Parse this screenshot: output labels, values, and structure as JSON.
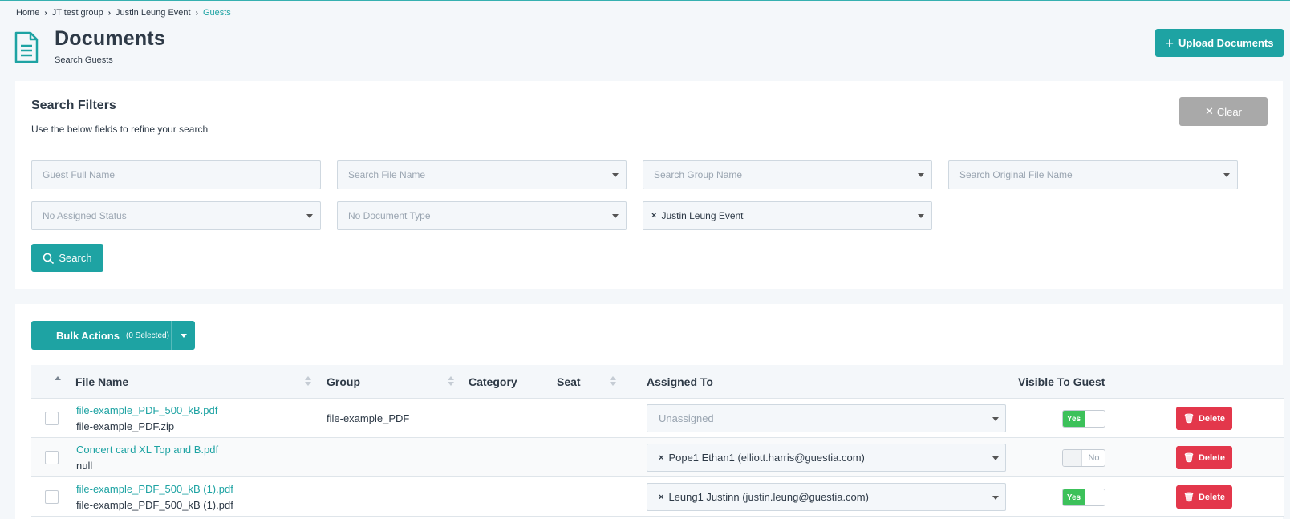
{
  "breadcrumb": {
    "items": [
      "Home",
      "JT test group",
      "Justin Leung Event"
    ],
    "current": "Guests"
  },
  "header": {
    "title": "Documents",
    "subtitle": "Search Guests",
    "upload_label": "Upload Documents",
    "icon": "document-icon"
  },
  "filters": {
    "title": "Search Filters",
    "description": "Use the below fields to refine your search",
    "clear_label": "Clear",
    "guest_name_placeholder": "Guest Full Name",
    "file_name_placeholder": "Search File Name",
    "group_name_placeholder": "Search Group Name",
    "original_file_placeholder": "Search Original File Name",
    "assigned_status_placeholder": "No Assigned Status",
    "document_type_placeholder": "No Document Type",
    "event_selected": "Justin Leung Event",
    "search_label": "Search"
  },
  "bulk": {
    "label": "Bulk Actions",
    "count": "(0 Selected)"
  },
  "table": {
    "columns": {
      "file_name": "File Name",
      "group": "Group",
      "category": "Category",
      "seat": "Seat",
      "assigned_to": "Assigned To",
      "visible": "Visible To Guest"
    },
    "rows": [
      {
        "file_name": "file-example_PDF_500_kB.pdf",
        "original": "file-example_PDF.zip",
        "group": "file-example_PDF",
        "assigned": "Unassigned",
        "visible_label": "Yes",
        "delete_label": "Delete"
      },
      {
        "file_name": "Concert card XL Top and B.pdf",
        "original": "null",
        "group": "",
        "assigned": "Pope1 Ethan1 (elliott.harris@guestia.com)",
        "visible_label": "No",
        "delete_label": "Delete"
      },
      {
        "file_name": "file-example_PDF_500_kB (1).pdf",
        "original": "file-example_PDF_500_kB (1).pdf",
        "group": "",
        "assigned": "Leung1 Justinn (justin.leung@guestia.com)",
        "visible_label": "Yes",
        "delete_label": "Delete"
      }
    ]
  },
  "colors": {
    "accent": "#1ea3a3",
    "danger": "#e3374b",
    "success": "#3cc15a",
    "muted_button": "#a9a9a9"
  }
}
